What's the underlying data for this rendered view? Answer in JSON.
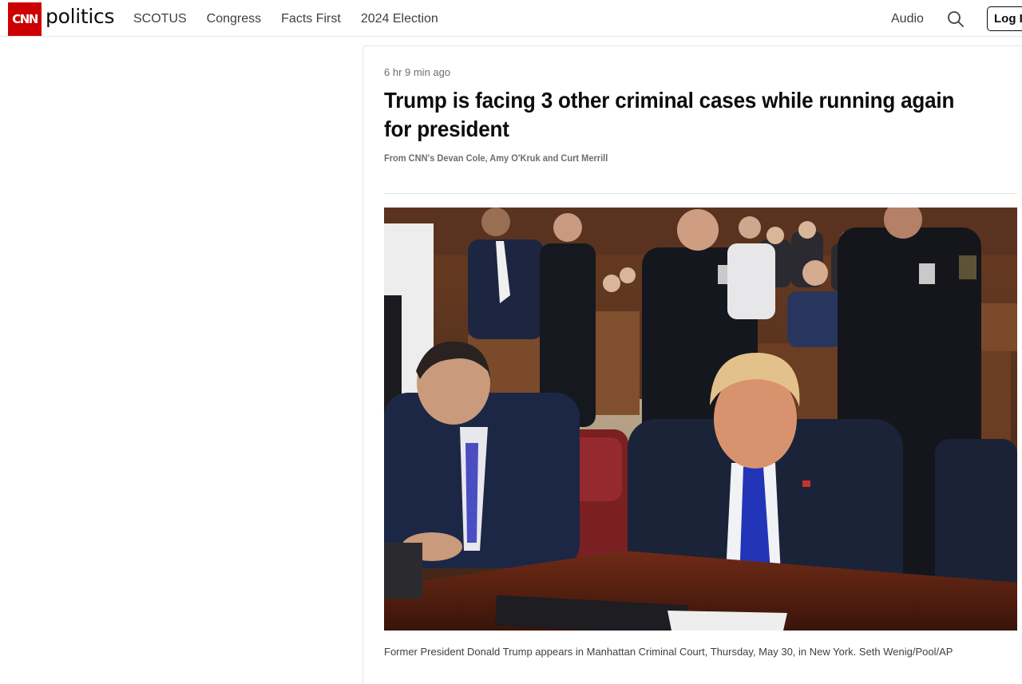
{
  "header": {
    "logo_text": "CNN",
    "section_name": "politics",
    "nav": [
      "SCOTUS",
      "Congress",
      "Facts First",
      "2024 Election"
    ],
    "audio_label": "Audio",
    "search_icon": "search-icon",
    "login_label": "Log In"
  },
  "article": {
    "timestamp": "6 hr 9 min ago",
    "headline": "Trump is facing 3 other criminal cases while running again for president",
    "byline": "From CNN's Devan Cole, Amy O'Kruk and Curt Merrill",
    "photo_caption": "Former President Donald Trump appears in Manhattan Criminal Court, Thursday, May 30, in New York. Seth Wenig/Pool/AP"
  },
  "colors": {
    "brand_red": "#cc0000",
    "text_dark": "#0c0c0c",
    "text_muted": "#6e6e6e",
    "border": "#e6e6e6"
  }
}
